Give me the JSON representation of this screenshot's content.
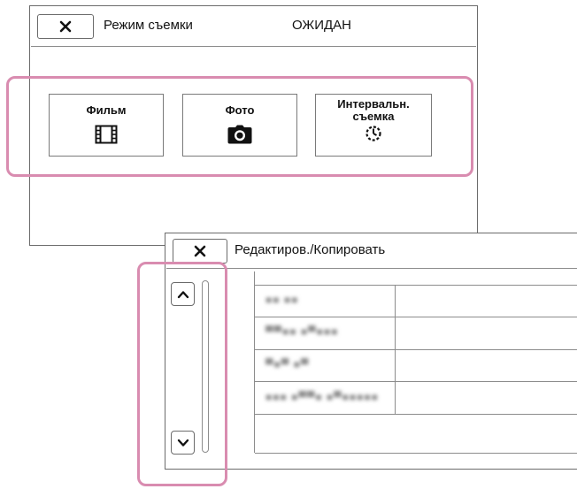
{
  "shoot_panel": {
    "title": "Режим съемки",
    "status": "ОЖИДАН",
    "modes": [
      {
        "label": "Фильм",
        "icon": "film-icon"
      },
      {
        "label": "Фото",
        "icon": "camera-icon"
      },
      {
        "label": "Интервальн. съемка",
        "icon": "interval-timer-icon"
      }
    ]
  },
  "edit_panel": {
    "title": "Редактиров./Копировать",
    "items": [
      "■■ ■■",
      "▀▀■■ ■▀■■■",
      "▀■▀ ■▀",
      "■■■ ■▀▀■ ■▀■■■■■"
    ]
  },
  "colors": {
    "highlight": "#d98cb0",
    "border": "#6b6b6b"
  }
}
